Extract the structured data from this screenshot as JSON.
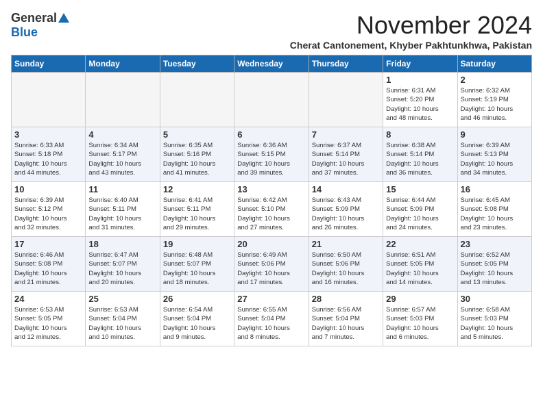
{
  "header": {
    "logo_general": "General",
    "logo_blue": "Blue",
    "month": "November 2024",
    "location": "Cherat Cantonement, Khyber Pakhtunkhwa, Pakistan"
  },
  "weekdays": [
    "Sunday",
    "Monday",
    "Tuesday",
    "Wednesday",
    "Thursday",
    "Friday",
    "Saturday"
  ],
  "weeks": [
    [
      {
        "day": "",
        "info": ""
      },
      {
        "day": "",
        "info": ""
      },
      {
        "day": "",
        "info": ""
      },
      {
        "day": "",
        "info": ""
      },
      {
        "day": "",
        "info": ""
      },
      {
        "day": "1",
        "info": "Sunrise: 6:31 AM\nSunset: 5:20 PM\nDaylight: 10 hours\nand 48 minutes."
      },
      {
        "day": "2",
        "info": "Sunrise: 6:32 AM\nSunset: 5:19 PM\nDaylight: 10 hours\nand 46 minutes."
      }
    ],
    [
      {
        "day": "3",
        "info": "Sunrise: 6:33 AM\nSunset: 5:18 PM\nDaylight: 10 hours\nand 44 minutes."
      },
      {
        "day": "4",
        "info": "Sunrise: 6:34 AM\nSunset: 5:17 PM\nDaylight: 10 hours\nand 43 minutes."
      },
      {
        "day": "5",
        "info": "Sunrise: 6:35 AM\nSunset: 5:16 PM\nDaylight: 10 hours\nand 41 minutes."
      },
      {
        "day": "6",
        "info": "Sunrise: 6:36 AM\nSunset: 5:15 PM\nDaylight: 10 hours\nand 39 minutes."
      },
      {
        "day": "7",
        "info": "Sunrise: 6:37 AM\nSunset: 5:14 PM\nDaylight: 10 hours\nand 37 minutes."
      },
      {
        "day": "8",
        "info": "Sunrise: 6:38 AM\nSunset: 5:14 PM\nDaylight: 10 hours\nand 36 minutes."
      },
      {
        "day": "9",
        "info": "Sunrise: 6:39 AM\nSunset: 5:13 PM\nDaylight: 10 hours\nand 34 minutes."
      }
    ],
    [
      {
        "day": "10",
        "info": "Sunrise: 6:39 AM\nSunset: 5:12 PM\nDaylight: 10 hours\nand 32 minutes."
      },
      {
        "day": "11",
        "info": "Sunrise: 6:40 AM\nSunset: 5:11 PM\nDaylight: 10 hours\nand 31 minutes."
      },
      {
        "day": "12",
        "info": "Sunrise: 6:41 AM\nSunset: 5:11 PM\nDaylight: 10 hours\nand 29 minutes."
      },
      {
        "day": "13",
        "info": "Sunrise: 6:42 AM\nSunset: 5:10 PM\nDaylight: 10 hours\nand 27 minutes."
      },
      {
        "day": "14",
        "info": "Sunrise: 6:43 AM\nSunset: 5:09 PM\nDaylight: 10 hours\nand 26 minutes."
      },
      {
        "day": "15",
        "info": "Sunrise: 6:44 AM\nSunset: 5:09 PM\nDaylight: 10 hours\nand 24 minutes."
      },
      {
        "day": "16",
        "info": "Sunrise: 6:45 AM\nSunset: 5:08 PM\nDaylight: 10 hours\nand 23 minutes."
      }
    ],
    [
      {
        "day": "17",
        "info": "Sunrise: 6:46 AM\nSunset: 5:08 PM\nDaylight: 10 hours\nand 21 minutes."
      },
      {
        "day": "18",
        "info": "Sunrise: 6:47 AM\nSunset: 5:07 PM\nDaylight: 10 hours\nand 20 minutes."
      },
      {
        "day": "19",
        "info": "Sunrise: 6:48 AM\nSunset: 5:07 PM\nDaylight: 10 hours\nand 18 minutes."
      },
      {
        "day": "20",
        "info": "Sunrise: 6:49 AM\nSunset: 5:06 PM\nDaylight: 10 hours\nand 17 minutes."
      },
      {
        "day": "21",
        "info": "Sunrise: 6:50 AM\nSunset: 5:06 PM\nDaylight: 10 hours\nand 16 minutes."
      },
      {
        "day": "22",
        "info": "Sunrise: 6:51 AM\nSunset: 5:05 PM\nDaylight: 10 hours\nand 14 minutes."
      },
      {
        "day": "23",
        "info": "Sunrise: 6:52 AM\nSunset: 5:05 PM\nDaylight: 10 hours\nand 13 minutes."
      }
    ],
    [
      {
        "day": "24",
        "info": "Sunrise: 6:53 AM\nSunset: 5:05 PM\nDaylight: 10 hours\nand 12 minutes."
      },
      {
        "day": "25",
        "info": "Sunrise: 6:53 AM\nSunset: 5:04 PM\nDaylight: 10 hours\nand 10 minutes."
      },
      {
        "day": "26",
        "info": "Sunrise: 6:54 AM\nSunset: 5:04 PM\nDaylight: 10 hours\nand 9 minutes."
      },
      {
        "day": "27",
        "info": "Sunrise: 6:55 AM\nSunset: 5:04 PM\nDaylight: 10 hours\nand 8 minutes."
      },
      {
        "day": "28",
        "info": "Sunrise: 6:56 AM\nSunset: 5:04 PM\nDaylight: 10 hours\nand 7 minutes."
      },
      {
        "day": "29",
        "info": "Sunrise: 6:57 AM\nSunset: 5:03 PM\nDaylight: 10 hours\nand 6 minutes."
      },
      {
        "day": "30",
        "info": "Sunrise: 6:58 AM\nSunset: 5:03 PM\nDaylight: 10 hours\nand 5 minutes."
      }
    ]
  ]
}
